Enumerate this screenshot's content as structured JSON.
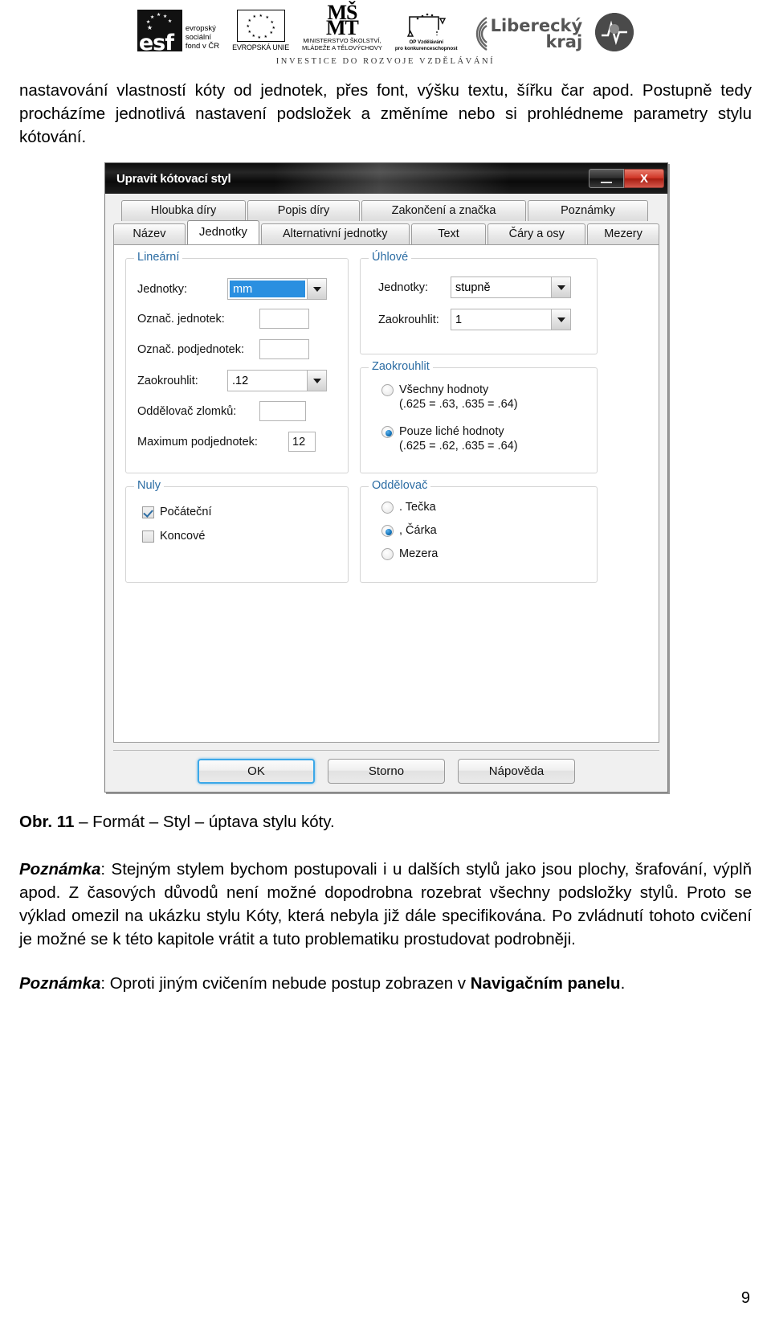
{
  "header": {
    "esf_caption_lines": [
      "evropský",
      "sociální",
      "fond v ČR"
    ],
    "esf_wordmark": "esf",
    "eu_label": "EVROPSKÁ UNIE",
    "msmt_mark_line1": "MŠ",
    "msmt_mark_line2": "MT",
    "msmt_caption_line1": "MINISTERSTVO ŠKOLSTVÍ,",
    "msmt_caption_line2": "MLÁDEŽE A TĚLOVÝCHOVY",
    "op_caption_line1": "OP Vzdělávání",
    "op_caption_line2": "pro konkurenceschopnost",
    "liberecky_line1": "Liberecký",
    "liberecky_line2": "kraj",
    "investice_line": "INVESTICE DO ROZVOJE VZDĚLÁVÁNÍ"
  },
  "intro_paragraph": "nastavování vlastností kóty od jednotek, přes font, výšku textu, šířku čar apod. Postupně tedy procházíme jednotlivá nastavení podsložek a změníme nebo si prohlédneme parametry stylu kótování.",
  "figure": {
    "caption_bold": "Obr. 11",
    "caption_rest": " – Formát – Styl – úptava stylu kóty.",
    "dialog": {
      "title": "Upravit kótovací styl",
      "minimize_tooltip": "Minimalizovat",
      "close_label": "X",
      "tabs_row_top": [
        {
          "label": "Hloubka díry",
          "class": "t-hloubka",
          "active": false
        },
        {
          "label": "Popis díry",
          "class": "t-popis",
          "active": false
        },
        {
          "label": "Zakončení a značka",
          "class": "t-zakonc",
          "active": false
        },
        {
          "label": "Poznámky",
          "class": "t-poznam",
          "active": false
        }
      ],
      "tabs_row_bottom": [
        {
          "label": "Název",
          "class": "t-nazev",
          "active": false
        },
        {
          "label": "Jednotky",
          "class": "t-alt-active",
          "active": true
        },
        {
          "label": "Alternativní jednotky",
          "class": "t-alt",
          "active": false
        },
        {
          "label": "Text",
          "class": "t-text",
          "active": false
        },
        {
          "label": "Čáry a osy",
          "class": "t-cary",
          "active": false
        },
        {
          "label": "Mezery",
          "class": "t-mezery",
          "active": false
        }
      ],
      "groups": {
        "linear": {
          "legend": "Lineární",
          "jednotky_label": "Jednotky:",
          "jednotky_value": "mm",
          "oznac_jednotek_label": "Označ. jednotek:",
          "oznac_jednotek_value": "",
          "oznac_podjednotek_label": "Označ. podjednotek:",
          "oznac_podjednotek_value": "",
          "zaokrouhlit_label": "Zaokrouhlit:",
          "zaokrouhlit_value": ".12",
          "oddelovac_zlomku_label": "Oddělovač zlomků:",
          "oddelovac_zlomku_value": "",
          "maximum_podjednotek_label": "Maximum podjednotek:",
          "maximum_podjednotek_value": "12"
        },
        "nuly": {
          "legend": "Nuly",
          "pocatecni_label": "Počáteční",
          "pocatecni_checked": true,
          "koncove_label": "Koncové",
          "koncove_checked": false
        },
        "uhlove": {
          "legend": "Úhlové",
          "jednotky_label": "Jednotky:",
          "jednotky_value": "stupně",
          "zaokrouhlit_label": "Zaokrouhlit:",
          "zaokrouhlit_value": "1"
        },
        "zaokrouhlit": {
          "legend": "Zaokrouhlit",
          "option1_label": "Všechny hodnoty\n(.625 = .63, .635 = .64)",
          "option1_selected": false,
          "option2_label": "Pouze liché hodnoty\n(.625 = .62, .635 = .64)",
          "option2_selected": true
        },
        "oddelovac": {
          "legend": "Oddělovač",
          "option1_label": ". Tečka",
          "option1_selected": false,
          "option2_label": ", Čárka",
          "option2_selected": true,
          "option3_label": "Mezera",
          "option3_selected": false
        }
      },
      "buttons": {
        "ok": "OK",
        "storno": "Storno",
        "napoveda": "Nápověda"
      }
    }
  },
  "note1": {
    "label": "Poznámka",
    "text": ": Stejným stylem bychom postupovali i u dalších stylů jako jsou plochy, šrafování, výplň apod. Z časových důvodů není možné dopodrobna rozebrat všechny podsložky stylů. Proto se výklad omezil na ukázku stylu Kóty, která nebyla již dále specifikována. Po zvládnutí tohoto cvičení je možné se k této kapitole vrátit a tuto problematiku prostudovat podrobněji."
  },
  "note2": {
    "label": "Poznámka",
    "text_before": ": Oproti jiným cvičením nebude postup zobrazen v ",
    "bold_part": "Navigačním panelu",
    "text_after": "."
  },
  "page_number": "9"
}
